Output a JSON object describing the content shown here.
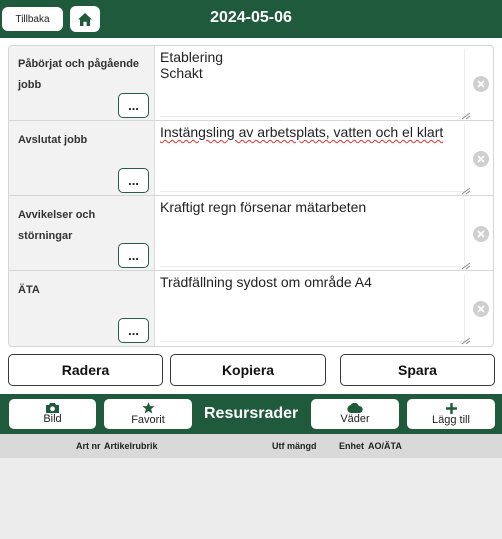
{
  "header": {
    "back_label": "Tillbaka",
    "date": "2024-05-06"
  },
  "form": {
    "rows": [
      {
        "label": "Påbörjat och pågående jobb",
        "value": "Etablering\nSchakt",
        "button": "..."
      },
      {
        "label": "Avslutat jobb",
        "value": "Instängsling av arbetsplats, vatten och el klart",
        "button": "..."
      },
      {
        "label": "Avvikelser och störningar",
        "value": "Kraftigt regn försenar mätarbeten",
        "button": "..."
      },
      {
        "label": "ÄTA",
        "value": "Trädfällning sydost om område A4",
        "button": "..."
      }
    ]
  },
  "actions": {
    "delete": "Radera",
    "copy": "Kopiera",
    "save": "Spara"
  },
  "resources": {
    "title": "Resursrader",
    "image_label": "Bild",
    "favorite_label": "Favorit",
    "weather_label": "Väder",
    "add_label": "Lägg till"
  },
  "table": {
    "columns": [
      "Art nr",
      "Artikelrubrik",
      "Utf mängd",
      "Enhet",
      "AO/ÄTA"
    ]
  },
  "colors": {
    "brand_green": "#1f5a3d"
  }
}
